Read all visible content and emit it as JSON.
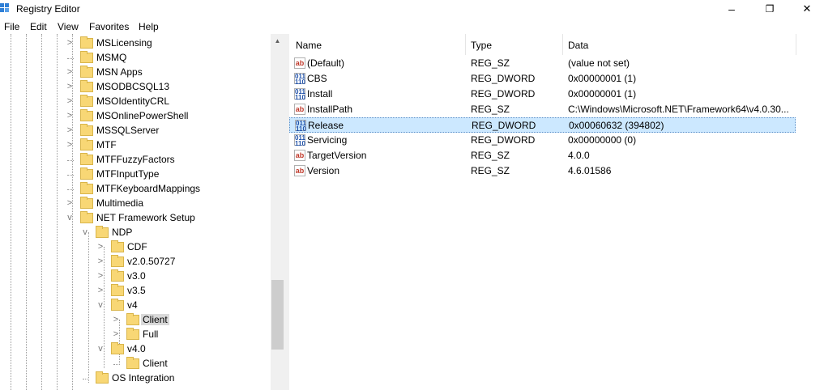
{
  "window": {
    "title": "Registry Editor",
    "minimize": "–",
    "maximize": "❐",
    "close": "✕"
  },
  "menu": [
    "File",
    "Edit",
    "View",
    "Favorites",
    "Help"
  ],
  "tree": {
    "nodes": [
      {
        "label": "MSLicensing",
        "level": 0,
        "expander": ">"
      },
      {
        "label": "MSMQ",
        "level": 0,
        "expander": ""
      },
      {
        "label": "MSN Apps",
        "level": 0,
        "expander": ">"
      },
      {
        "label": "MSODBCSQL13",
        "level": 0,
        "expander": ">"
      },
      {
        "label": "MSOIdentityCRL",
        "level": 0,
        "expander": ">"
      },
      {
        "label": "MSOnlinePowerShell",
        "level": 0,
        "expander": ">"
      },
      {
        "label": "MSSQLServer",
        "level": 0,
        "expander": ">"
      },
      {
        "label": "MTF",
        "level": 0,
        "expander": ">"
      },
      {
        "label": "MTFFuzzyFactors",
        "level": 0,
        "expander": ""
      },
      {
        "label": "MTFInputType",
        "level": 0,
        "expander": ""
      },
      {
        "label": "MTFKeyboardMappings",
        "level": 0,
        "expander": ""
      },
      {
        "label": "Multimedia",
        "level": 0,
        "expander": ">"
      },
      {
        "label": "NET Framework Setup",
        "level": 0,
        "expander": "v"
      },
      {
        "label": "NDP",
        "level": 1,
        "expander": "v"
      },
      {
        "label": "CDF",
        "level": 2,
        "expander": ">"
      },
      {
        "label": "v2.0.50727",
        "level": 2,
        "expander": ">"
      },
      {
        "label": "v3.0",
        "level": 2,
        "expander": ">"
      },
      {
        "label": "v3.5",
        "level": 2,
        "expander": ">"
      },
      {
        "label": "v4",
        "level": 2,
        "expander": "v"
      },
      {
        "label": "Client",
        "level": 3,
        "expander": ">",
        "selected": true
      },
      {
        "label": "Full",
        "level": 3,
        "expander": ">"
      },
      {
        "label": "v4.0",
        "level": 2,
        "expander": "v"
      },
      {
        "label": "Client",
        "level": 3,
        "expander": ""
      },
      {
        "label": "OS Integration",
        "level": 1,
        "expander": ""
      }
    ]
  },
  "list": {
    "columns": [
      "Name",
      "Type",
      "Data"
    ],
    "rows": [
      {
        "icon": "string-value-icon",
        "glyph": "ab",
        "name": "(Default)",
        "type": "REG_SZ",
        "data": "(value not set)"
      },
      {
        "icon": "dword-value-icon",
        "glyph": "011\n110",
        "name": "CBS",
        "type": "REG_DWORD",
        "data": "0x00000001 (1)"
      },
      {
        "icon": "dword-value-icon",
        "glyph": "011\n110",
        "name": "Install",
        "type": "REG_DWORD",
        "data": "0x00000001 (1)"
      },
      {
        "icon": "string-value-icon",
        "glyph": "ab",
        "name": "InstallPath",
        "type": "REG_SZ",
        "data": "C:\\Windows\\Microsoft.NET\\Framework64\\v4.0.30..."
      },
      {
        "icon": "dword-value-icon",
        "glyph": "011\n110",
        "name": "Release",
        "type": "REG_DWORD",
        "data": "0x00060632 (394802)",
        "selected": true
      },
      {
        "icon": "dword-value-icon",
        "glyph": "011\n110",
        "name": "Servicing",
        "type": "REG_DWORD",
        "data": "0x00000000 (0)"
      },
      {
        "icon": "string-value-icon",
        "glyph": "ab",
        "name": "TargetVersion",
        "type": "REG_SZ",
        "data": "4.0.0"
      },
      {
        "icon": "string-value-icon",
        "glyph": "ab",
        "name": "Version",
        "type": "REG_SZ",
        "data": "4.6.01586"
      }
    ]
  },
  "scrollbar": {
    "up": "▲",
    "down": "▼"
  }
}
